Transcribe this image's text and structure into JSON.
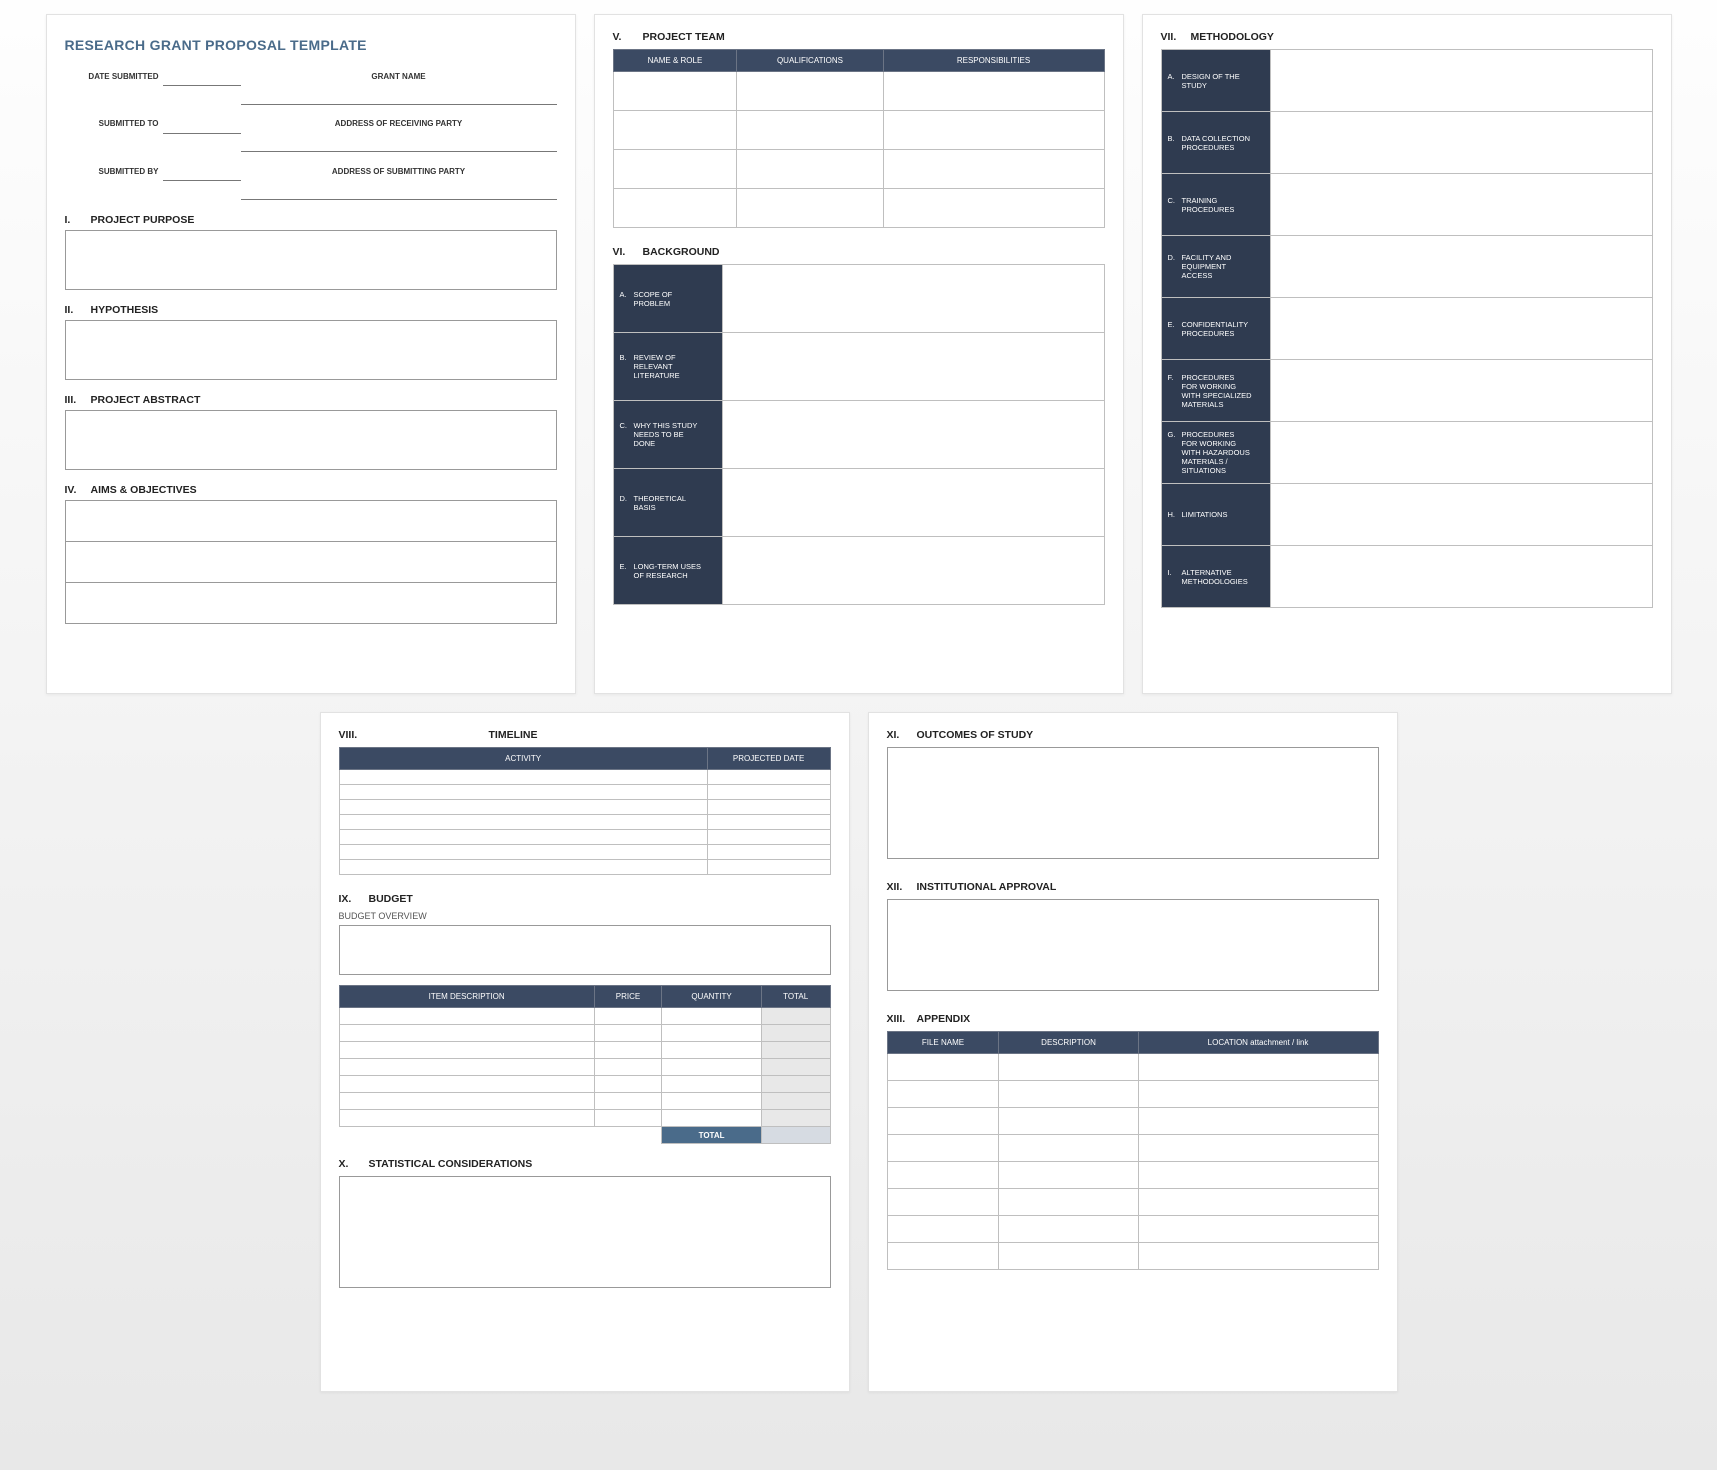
{
  "page1": {
    "title": "RESEARCH GRANT PROPOSAL TEMPLATE",
    "meta": {
      "date_submitted": "DATE SUBMITTED",
      "grant_name": "GRANT NAME",
      "submitted_to": "SUBMITTED TO",
      "address_receiving": "ADDRESS OF RECEIVING PARTY",
      "submitted_by": "SUBMITTED BY",
      "address_submitting": "ADDRESS OF SUBMITTING PARTY"
    },
    "sections": {
      "i": {
        "num": "I.",
        "label": "PROJECT PURPOSE"
      },
      "ii": {
        "num": "II.",
        "label": "HYPOTHESIS"
      },
      "iii": {
        "num": "III.",
        "label": "PROJECT ABSTRACT"
      },
      "iv": {
        "num": "IV.",
        "label": "AIMS & OBJECTIVES"
      }
    }
  },
  "page2": {
    "team": {
      "num": "V.",
      "label": "PROJECT TEAM",
      "headers": [
        "NAME & ROLE",
        "QUALIFICATIONS",
        "RESPONSIBILITIES"
      ]
    },
    "background": {
      "num": "VI.",
      "label": "BACKGROUND",
      "rows": [
        {
          "let": "A.",
          "txt": "SCOPE OF PROBLEM"
        },
        {
          "let": "B.",
          "txt": "REVIEW OF RELEVANT LITERATURE"
        },
        {
          "let": "C.",
          "txt": "WHY THIS STUDY NEEDS TO BE DONE"
        },
        {
          "let": "D.",
          "txt": "THEORETICAL BASIS"
        },
        {
          "let": "E.",
          "txt": "LONG-TERM USES OF RESEARCH"
        }
      ]
    }
  },
  "page3": {
    "methodology": {
      "num": "VII.",
      "label": "METHODOLOGY",
      "rows": [
        {
          "let": "A.",
          "txt": "DESIGN OF THE STUDY"
        },
        {
          "let": "B.",
          "txt": "DATA COLLECTION PROCEDURES"
        },
        {
          "let": "C.",
          "txt": "TRAINING PROCEDURES"
        },
        {
          "let": "D.",
          "txt": "FACILITY AND EQUIPMENT ACCESS"
        },
        {
          "let": "E.",
          "txt": "CONFIDENTIALITY PROCEDURES"
        },
        {
          "let": "F.",
          "txt": "PROCEDURES FOR WORKING WITH SPECIALIZED MATERIALS"
        },
        {
          "let": "G.",
          "txt": "PROCEDURES FOR WORKING WITH HAZARDOUS MATERIALS / SITUATIONS"
        },
        {
          "let": "H.",
          "txt": "LIMITATIONS"
        },
        {
          "let": "I.",
          "txt": "ALTERNATIVE METHODOLOGIES"
        }
      ]
    }
  },
  "page4": {
    "timeline": {
      "num": "VIII.",
      "label": "TIMELINE",
      "headers": [
        "ACTIVITY",
        "PROJECTED DATE"
      ]
    },
    "budget": {
      "num": "IX.",
      "label": "BUDGET",
      "overview_label": "BUDGET OVERVIEW",
      "headers": [
        "ITEM DESCRIPTION",
        "PRICE",
        "QUANTITY",
        "TOTAL"
      ],
      "total_label": "TOTAL"
    },
    "stats": {
      "num": "X.",
      "label": "STATISTICAL CONSIDERATIONS"
    }
  },
  "page5": {
    "outcomes": {
      "num": "XI.",
      "label": "OUTCOMES OF STUDY"
    },
    "approval": {
      "num": "XII.",
      "label": "INSTITUTIONAL APPROVAL"
    },
    "appendix": {
      "num": "XIII.",
      "label": "APPENDIX",
      "headers": [
        "FILE NAME",
        "DESCRIPTION",
        "LOCATION attachment / link"
      ]
    }
  }
}
